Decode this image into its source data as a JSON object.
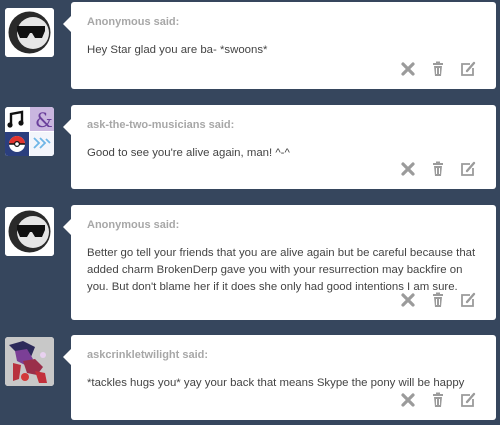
{
  "posts": [
    {
      "asker": "Anonymous said:",
      "question": "Hey Star glad you are ba- *swoons*"
    },
    {
      "asker": "ask-the-two-musicians said:",
      "question": "Good to see you're alive again, man! ^-^"
    },
    {
      "asker": "Anonymous said:",
      "question": "Better go tell your friends that you are alive again but be careful because that added charm BrokenDerp gave you with your resurrection may backfire on you. But don't blame her if it does she only had good intentions I am sure."
    },
    {
      "asker": "askcrinkletwilight said:",
      "question": "*tackles hugs you* yay your back that means Skype the pony will be happy"
    }
  ],
  "colors": {
    "background": "#36465d",
    "card": "#ffffff",
    "asker": "#a7a7a7",
    "text": "#444444",
    "icon": "#9b9b9b"
  },
  "icons": [
    "delete-icon",
    "trash-icon",
    "edit-icon"
  ]
}
